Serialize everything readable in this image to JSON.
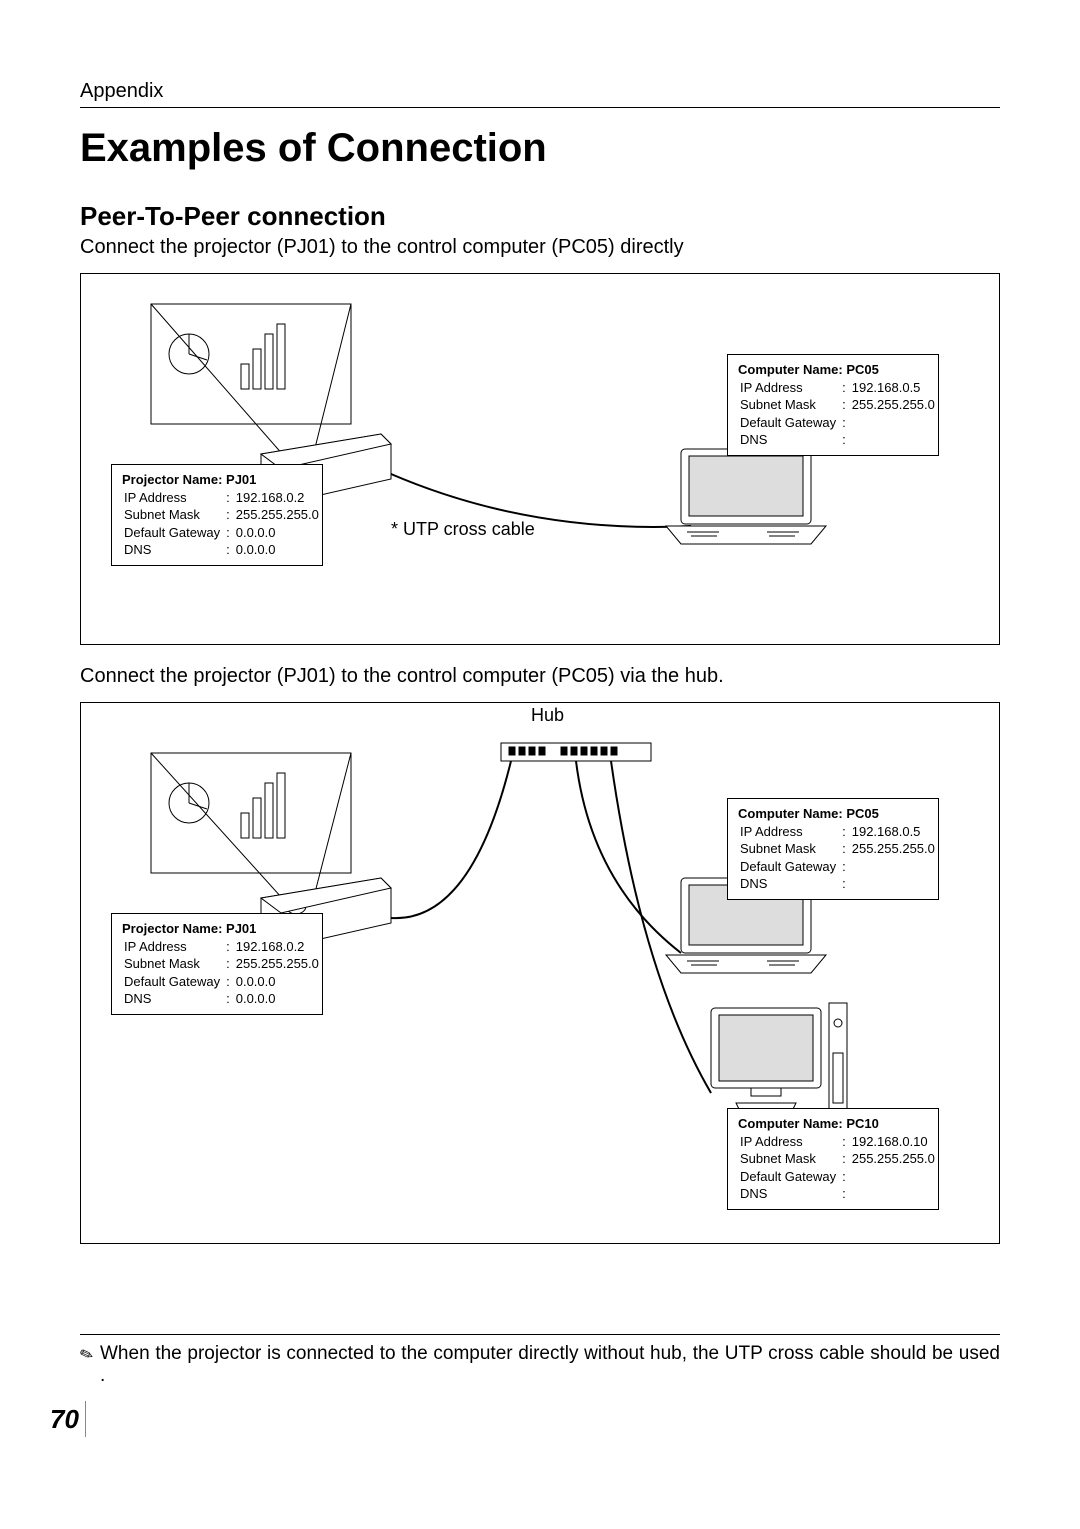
{
  "header": {
    "appendix": "Appendix"
  },
  "title": "Examples of Connection",
  "subtitle": "Peer-To-Peer connection",
  "text1": "Connect the projector (PJ01) to the control computer (PC05) directly",
  "diagram1": {
    "cable_label": "* UTP cross cable",
    "projector": {
      "name": "Projector Name: PJ01",
      "rows": {
        "ip": {
          "label": "IP Address",
          "value": "192.168.0.2"
        },
        "mask": {
          "label": "Subnet Mask",
          "value": "255.255.255.0"
        },
        "gw": {
          "label": "Default Gateway",
          "value": "0.0.0.0"
        },
        "dns": {
          "label": "DNS",
          "value": "0.0.0.0"
        }
      }
    },
    "computer": {
      "name": "Computer Name: PC05",
      "rows": {
        "ip": {
          "label": "IP Address",
          "value": "192.168.0.5"
        },
        "mask": {
          "label": "Subnet Mask",
          "value": "255.255.255.0"
        },
        "gw": {
          "label": "Default Gateway",
          "value": ""
        },
        "dns": {
          "label": "DNS",
          "value": ""
        }
      }
    }
  },
  "text2": "Connect the projector (PJ01) to the control computer (PC05) via the hub.",
  "diagram2": {
    "hub_label": "Hub",
    "projector": {
      "name": "Projector Name: PJ01",
      "rows": {
        "ip": {
          "label": "IP Address",
          "value": "192.168.0.2"
        },
        "mask": {
          "label": "Subnet Mask",
          "value": "255.255.255.0"
        },
        "gw": {
          "label": "Default Gateway",
          "value": "0.0.0.0"
        },
        "dns": {
          "label": "DNS",
          "value": "0.0.0.0"
        }
      }
    },
    "pc05": {
      "name": "Computer Name: PC05",
      "rows": {
        "ip": {
          "label": "IP Address",
          "value": "192.168.0.5"
        },
        "mask": {
          "label": "Subnet Mask",
          "value": "255.255.255.0"
        },
        "gw": {
          "label": "Default Gateway",
          "value": ""
        },
        "dns": {
          "label": "DNS",
          "value": ""
        }
      }
    },
    "pc10": {
      "name": "Computer Name: PC10",
      "rows": {
        "ip": {
          "label": "IP Address",
          "value": "192.168.0.10"
        },
        "mask": {
          "label": "Subnet Mask",
          "value": "255.255.255.0"
        },
        "gw": {
          "label": "Default Gateway",
          "value": ""
        },
        "dns": {
          "label": "DNS",
          "value": ""
        }
      }
    }
  },
  "footnote": "When the projector is connected to the computer directly without hub, the UTP cross cable should be used .",
  "page_number": "70"
}
